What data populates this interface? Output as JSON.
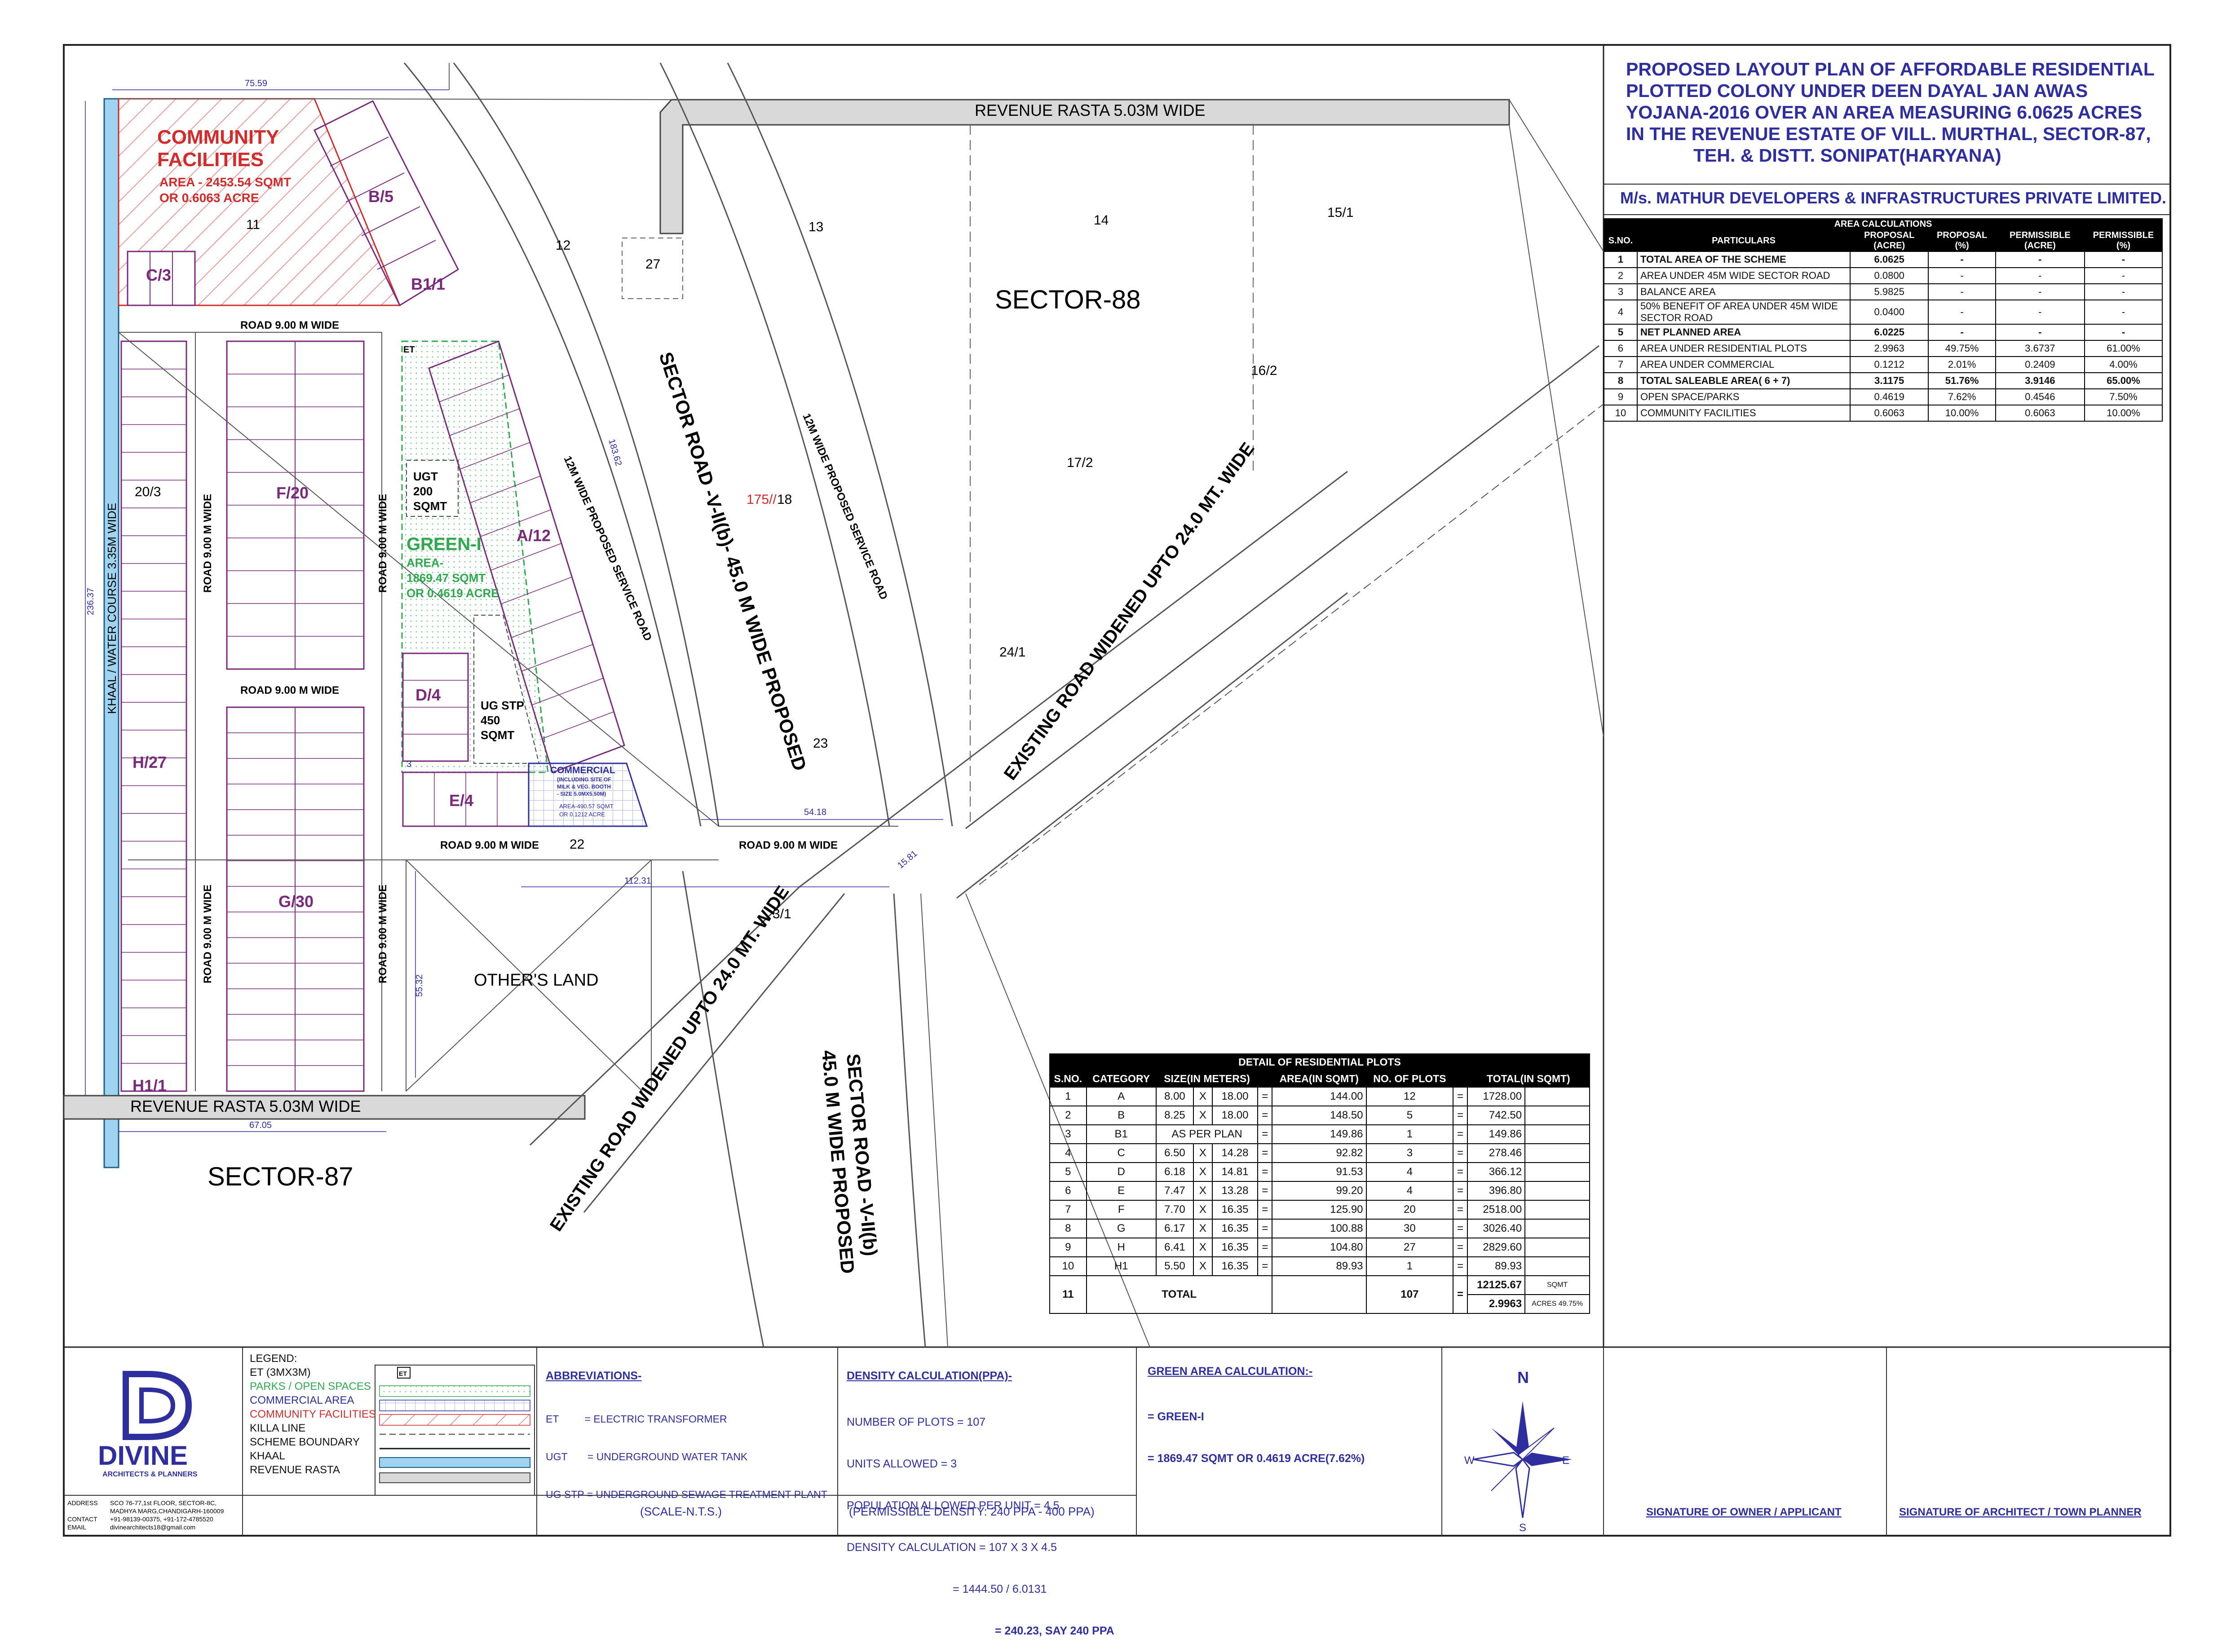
{
  "title": {
    "lines": [
      "PROPOSED LAYOUT PLAN OF AFFORDABLE RESIDENTIAL",
      "PLOTTED COLONY UNDER DEEN DAYAL JAN AWAS",
      "YOJANA-2016 OVER AN AREA MEASURING 6.0625 ACRES",
      "IN THE REVENUE ESTATE OF VILL. MURTHAL, SECTOR-87,",
      "TEH. & DISTT. SONIPAT(HARYANA)"
    ],
    "company": "M/s. MATHUR DEVELOPERS & INFRASTRUCTURES PRIVATE LIMITED."
  },
  "area_calc": {
    "heading": "AREA CALCULATIONS",
    "columns": [
      "S.NO.",
      "PARTICULARS",
      "PROPOSAL (ACRE)",
      "PROPOSAL (%)",
      "PERMISSIBLE (ACRE)",
      "PERMISSIBLE (%)"
    ],
    "rows": [
      [
        "1",
        "TOTAL AREA OF THE SCHEME",
        "6.0625",
        "-",
        "-",
        "-"
      ],
      [
        "2",
        "AREA UNDER 45M WIDE SECTOR ROAD",
        "0.0800",
        "-",
        "-",
        "-"
      ],
      [
        "3",
        "BALANCE AREA",
        "5.9825",
        "-",
        "-",
        "-"
      ],
      [
        "4",
        "50% BENEFIT OF AREA UNDER 45M WIDE SECTOR ROAD",
        "0.0400",
        "-",
        "-",
        "-"
      ],
      [
        "5",
        "NET PLANNED AREA",
        "6.0225",
        "-",
        "-",
        "-"
      ],
      [
        "6",
        "AREA UNDER RESIDENTIAL PLOTS",
        "2.9963",
        "49.75%",
        "3.6737",
        "61.00%"
      ],
      [
        "7",
        "AREA UNDER COMMERCIAL",
        "0.1212",
        "2.01%",
        "0.2409",
        "4.00%"
      ],
      [
        "8",
        "TOTAL SALEABLE AREA( 6 + 7)",
        "3.1175",
        "51.76%",
        "3.9146",
        "65.00%"
      ],
      [
        "9",
        "OPEN SPACE/PARKS",
        "0.4619",
        "7.62%",
        "0.4546",
        "7.50%"
      ],
      [
        "10",
        "COMMUNITY FACILITIES",
        "0.6063",
        "10.00%",
        "0.6063",
        "10.00%"
      ]
    ]
  },
  "residential": {
    "heading": "DETAIL OF RESIDENTIAL PLOTS",
    "columns": [
      "S.NO.",
      "CATEGORY",
      "SIZE(IN METERS)",
      "AREA(IN SQMT)",
      "NO. OF PLOTS",
      "TOTAL(IN SQMT)"
    ],
    "rows": [
      [
        "1",
        "A",
        "8.00",
        "18.00",
        "144.00",
        "12",
        "1728.00"
      ],
      [
        "2",
        "B",
        "8.25",
        "18.00",
        "148.50",
        "5",
        "742.50"
      ],
      [
        "3",
        "B1",
        "AS PER PLAN",
        "",
        "149.86",
        "1",
        "149.86"
      ],
      [
        "4",
        "C",
        "6.50",
        "14.28",
        "92.82",
        "3",
        "278.46"
      ],
      [
        "5",
        "D",
        "6.18",
        "14.81",
        "91.53",
        "4",
        "366.12"
      ],
      [
        "6",
        "E",
        "7.47",
        "13.28",
        "99.20",
        "4",
        "396.80"
      ],
      [
        "7",
        "F",
        "7.70",
        "16.35",
        "125.90",
        "20",
        "2518.00"
      ],
      [
        "8",
        "G",
        "6.17",
        "16.35",
        "100.88",
        "30",
        "3026.40"
      ],
      [
        "9",
        "H",
        "6.41",
        "16.35",
        "104.80",
        "27",
        "2829.60"
      ],
      [
        "10",
        "H1",
        "5.50",
        "16.35",
        "89.93",
        "1",
        "89.93"
      ]
    ],
    "total_sno": "11",
    "total_label": "TOTAL",
    "total_plots": "107",
    "total_sqmt": "12125.67",
    "total_acres": "2.9963",
    "unit_sqmt": "SQMT",
    "unit_acres": "ACRES",
    "total_pct": "49.75%",
    "x_sign": "X",
    "eq_sign": "="
  },
  "plan": {
    "community_title_1": "COMMUNITY",
    "community_title_2": "FACILITIES",
    "community_area_1": "AREA - 2453.54 SQMT",
    "community_area_2": "OR 0.6063 ACRE",
    "green_title": "GREEN-I",
    "green_area_1": "AREA-",
    "green_area_2": "1869.47 SQMT",
    "green_area_3": "OR 0.4619 ACRE",
    "ugt_1": "UGT",
    "ugt_2": "200",
    "ugt_3": "SQMT",
    "ugstp_1": "UG STP",
    "ugstp_2": "450",
    "ugstp_3": "SQMT",
    "commercial_1": "COMMERCIAL",
    "commercial_2": "(INCLUDING SITE OF",
    "commercial_3": "MILK & VEG. BOOTH",
    "commercial_4": "- SIZE 5.0MX5.50M)",
    "commercial_5": "AREA-490.57 SQMT",
    "commercial_6": "OR 0.1212 ACRE",
    "et": "ET",
    "blocks": {
      "b5": "B/5",
      "b11": "B1/1",
      "c3": "C/3",
      "f20": "F/20",
      "a12": "A/12",
      "d4": "D/4",
      "e4": "E/4",
      "h27": "H/27",
      "g30": "G/30",
      "h11": "H1/1"
    },
    "killa": [
      "11",
      "12",
      "13",
      "14",
      "15/1",
      "27",
      "16/2",
      "17/2",
      "175//",
      "18",
      "20/3",
      "24/1",
      "23",
      "22",
      "3/1"
    ],
    "roads": {
      "revenue_top": "REVENUE RASTA 5.03M WIDE",
      "revenue_bottom": "REVENUE RASTA 5.03M WIDE",
      "road9": "ROAD 9.00 M WIDE",
      "khaal": "KHAAL / WATER COURSE 3.35M WIDE",
      "service_road": "12M WIDE PROPOSED SERVICE ROAD",
      "sector_road_1": "SECTOR ROAD -V-II(b)- 45.0 M WIDE PROPOSED",
      "sector_road_2a": "SECTOR ROAD -V-II(b)",
      "sector_road_2b": "45.0 M WIDE PROPOSED",
      "existing": "EXISTING ROAD WIDENED UPTO 24.0 MT. WIDE"
    },
    "sector88": "SECTOR-88",
    "sector87": "SECTOR-87",
    "others_land": "OTHER'S LAND",
    "dims": {
      "d1": "75.59",
      "d2": "183.62",
      "d3": "236.37",
      "d4": "54.18",
      "d5": "112.31",
      "d6": "15.81",
      "d7": "55.32",
      "d8": "67.05",
      "d9": "3"
    }
  },
  "footer": {
    "logo_name": "DIVINE",
    "logo_sub": "ARCHITECTS & PLANNERS",
    "address_label": "ADDRESS",
    "address_1": "SCO 76-77,1st FLOOR, SECTOR-8C,",
    "address_2": "MADHYA MARG,CHANDIGARH-160009",
    "contact_label": "CONTACT",
    "contact": "+91-98139-00375, +91-172-4785520",
    "email_label": "EMAIL",
    "email": "divinearchitects18@gmail.com",
    "legend_title": "LEGEND:",
    "legend": [
      "ET (3MX3M)",
      "PARKS / OPEN SPACES",
      "COMMERCIAL AREA",
      "COMMUNITY FACILITIES",
      "KILLA LINE",
      "SCHEME BOUNDARY",
      "KHAAL",
      "REVENUE RASTA"
    ],
    "legend_colors": [
      "#111111",
      "#2fa84f",
      "#2e2e9e",
      "#d12b2b",
      "#111111",
      "#111111",
      "#111111",
      "#111111"
    ],
    "scale": "(SCALE-N.T.S.)",
    "abbr_title": "ABBREVIATIONS-",
    "abbr": [
      "ET         = ELECTRIC TRANSFORMER",
      "UGT       = UNDERGROUND WATER TANK",
      "UG STP = UNDERGROUND SEWAGE TREATMENT PLANT"
    ],
    "density_title": "DENSITY CALCULATION(PPA)-",
    "density": [
      "NUMBER OF PLOTS = 107",
      "UNITS ALLOWED = 3",
      "POPULATION ALLOWED PER UNIT = 4.5",
      "DENSITY CALCULATION = 107 X 3 X 4.5",
      "                                  = 1444.50 / 6.0131"
    ],
    "density_result": "= 240.23, SAY 240 PPA",
    "permissible_density": "(PERMISSIBLE DENSITY: 240 PPA - 400 PPA)",
    "green_title": "GREEN AREA CALCULATION:-",
    "green": [
      "= GREEN-I",
      "= 1869.47 SQMT OR 0.4619 ACRE(7.62%)"
    ],
    "compass": {
      "n": "N",
      "s": "S",
      "e": "E",
      "w": "W"
    },
    "sig_owner": "SIGNATURE OF OWNER / APPLICANT",
    "sig_arch": "SIGNATURE OF ARCHITECT / TOWN PLANNER"
  },
  "colors": {
    "accent_blue": "#2e2e9e",
    "community_red": "#d12b2b",
    "green": "#2fa84f",
    "block_purple": "#7a2a7a",
    "khaal_blue": "#9fd3ef"
  }
}
